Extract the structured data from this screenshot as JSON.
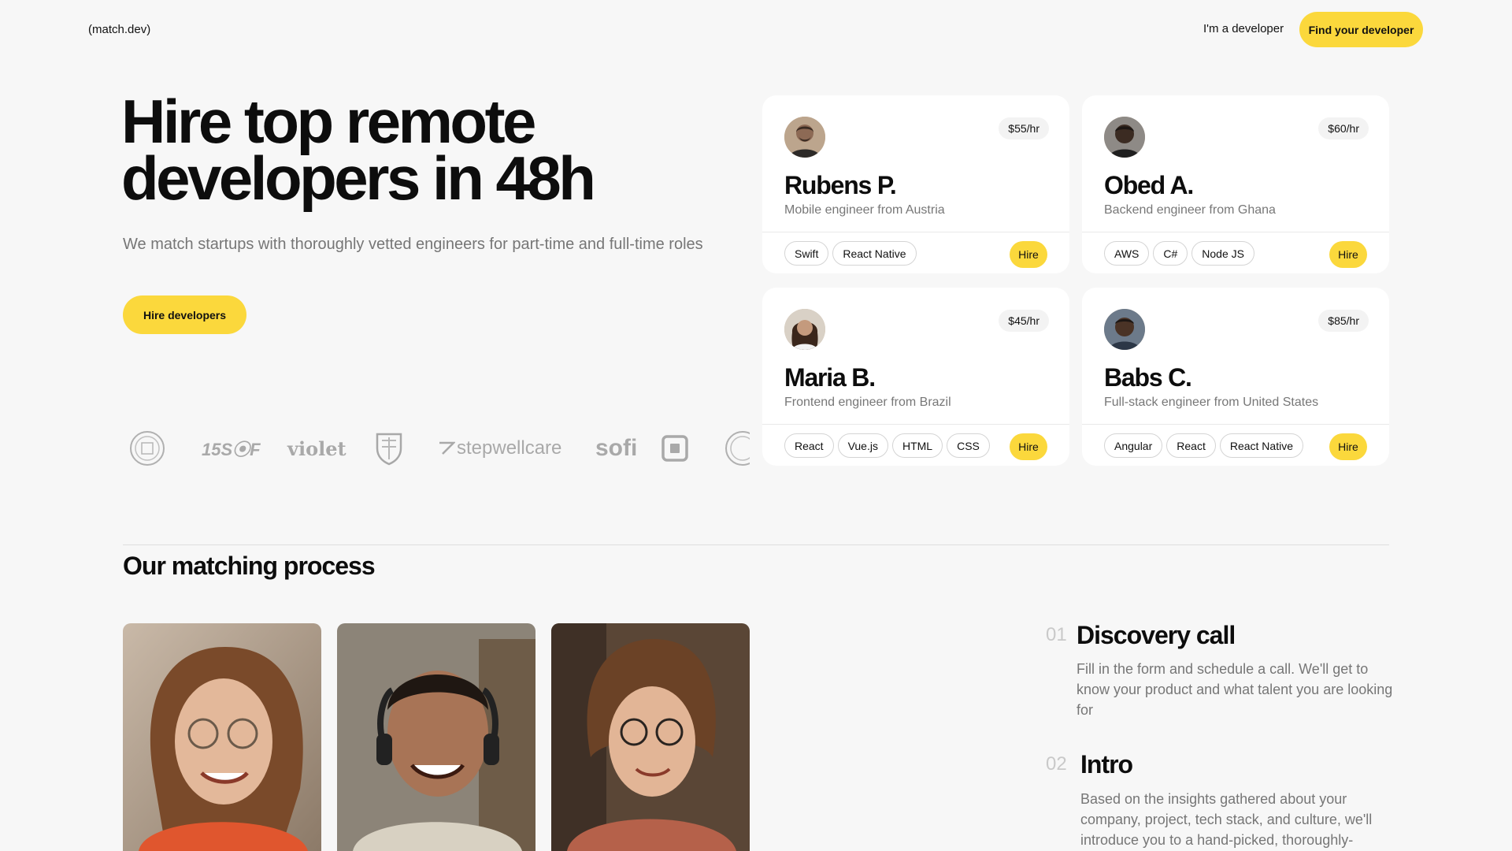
{
  "header": {
    "logo": "(match.dev)",
    "nav_developer": "I'm a developer",
    "cta": "Find your developer"
  },
  "hero": {
    "title_line1": "Hire top remote",
    "title_line2": "developers in 48h",
    "subtitle": "We match startups with thoroughly vetted engineers for part-time and full-time roles",
    "cta": "Hire developers"
  },
  "logos": {
    "items": [
      "university-seal-icon",
      "1550f-logo",
      "violet",
      "crest-icon",
      "stepwellcare",
      "sofi",
      "square-icon",
      "university-seal-icon"
    ],
    "fss": "15S⦿F",
    "violet": "violet",
    "stepwell": "stepwellcare",
    "sofi": "sofi"
  },
  "developers": [
    {
      "name": "Rubens P.",
      "role": "Mobile engineer from Austria",
      "rate": "$55/hr",
      "tags": [
        "Swift",
        "React Native"
      ],
      "hire": "Hire",
      "avatar_color": "#6e5a4b"
    },
    {
      "name": "Obed A.",
      "role": "Backend engineer from Ghana",
      "rate": "$60/hr",
      "tags": [
        "AWS",
        "C#",
        "Node JS"
      ],
      "hire": "Hire",
      "avatar_color": "#3b2b22"
    },
    {
      "name": "Maria B.",
      "role": "Frontend engineer from Brazil",
      "rate": "$45/hr",
      "tags": [
        "React",
        "Vue.js",
        "HTML",
        "CSS"
      ],
      "hire": "Hire",
      "avatar_color": "#5a3e2e"
    },
    {
      "name": "Babs C.",
      "role": "Full-stack engineer from United States",
      "rate": "$85/hr",
      "tags": [
        "Angular",
        "React",
        "React Native"
      ],
      "hire": "Hire",
      "avatar_color": "#2e2420"
    }
  ],
  "process": {
    "title": "Our matching process",
    "steps": [
      {
        "num": "01",
        "title": "Discovery call",
        "text": "Fill in the form and schedule a call. We'll get to know your product and what talent you are looking for"
      },
      {
        "num": "02",
        "title": "Intro",
        "text": "Based on the insights gathered about your company, project, tech stack, and culture, we'll introduce you to a hand-picked, thoroughly-"
      }
    ]
  },
  "colors": {
    "accent": "#fbd83c",
    "background": "#f7f7f7",
    "muted": "#767676"
  }
}
